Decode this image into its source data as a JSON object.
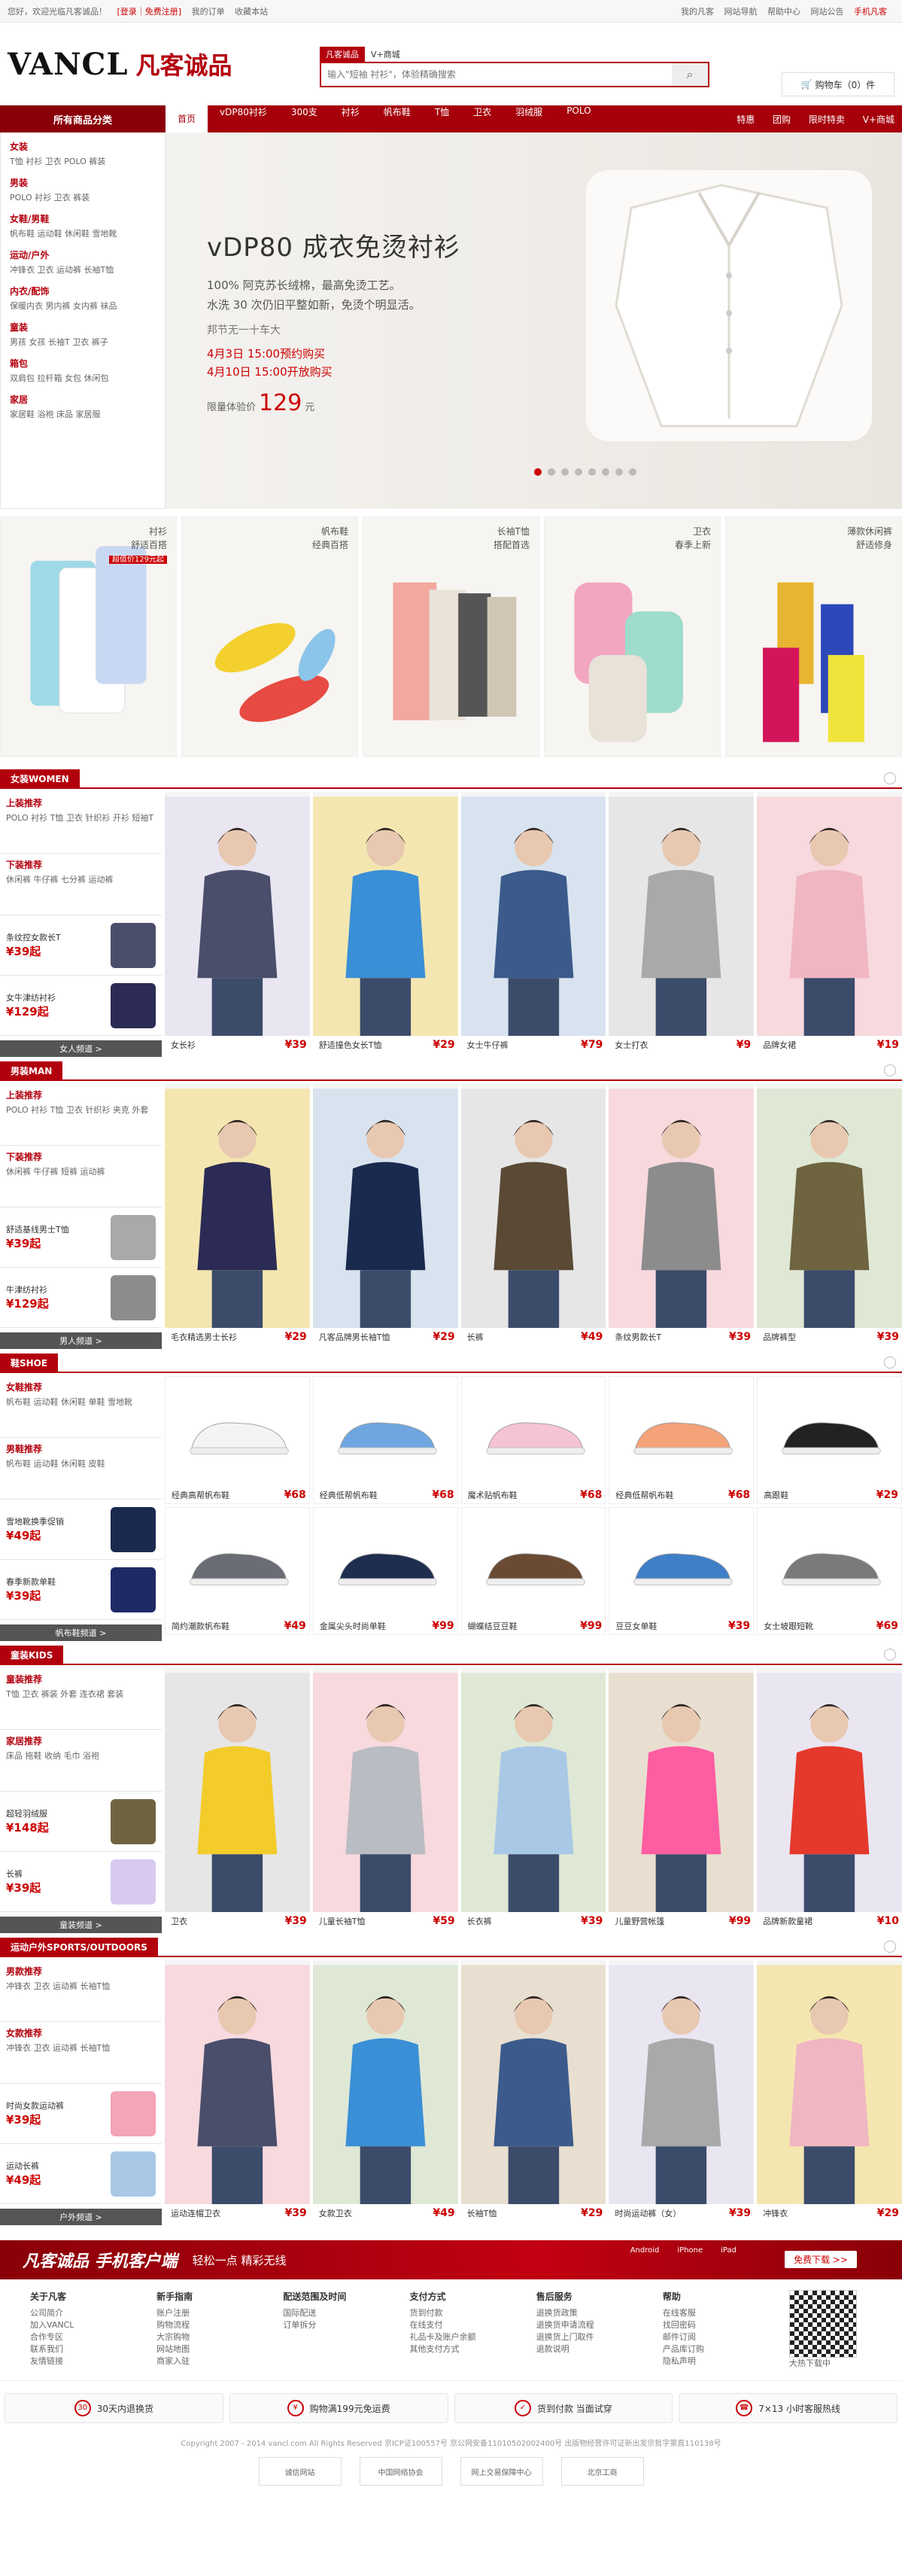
{
  "topbar": {
    "greeting": "您好，欢迎光临凡客诚品！",
    "login": "[登录｜免费注册]",
    "my_order": "我的订单",
    "favorites": "收藏本站",
    "right": [
      "我的凡客",
      "网站导航",
      "帮助中心",
      "网站公告",
      "手机凡客"
    ]
  },
  "header": {
    "logo_en": "VANCL",
    "logo_cn": "凡客诚品",
    "search_tabs": [
      "凡客诚品",
      "V+商城"
    ],
    "search_placeholder": "输入\"短袖 衬衫\"，体验精确搜索",
    "cart": "购物车（0）件"
  },
  "nav": {
    "all": "所有商品分类",
    "items": [
      "首页",
      "vDP80衬衫",
      "300支",
      "衬衫",
      "帆布鞋",
      "T恤",
      "卫衣",
      "羽绒服",
      "POLO"
    ],
    "right": [
      "特惠",
      "团购",
      "限时特卖",
      "V+商城"
    ]
  },
  "categories": [
    {
      "title": "女装",
      "sub": "T恤 衬衫 卫衣 POLO 裤装"
    },
    {
      "title": "男装",
      "sub": "POLO 衬衫 卫衣 裤装"
    },
    {
      "title": "女鞋/男鞋",
      "sub": "帆布鞋 运动鞋 休闲鞋 雪地靴"
    },
    {
      "title": "运动/户外",
      "sub": "冲锋衣 卫衣 运动裤 长袖T恤"
    },
    {
      "title": "内衣/配饰",
      "sub": "保暖内衣 男内裤 女内裤 袜品"
    },
    {
      "title": "童装",
      "sub": "男孩 女孩 长袖T 卫衣 裤子"
    },
    {
      "title": "箱包",
      "sub": "双肩包 拉杆箱 女包 休闲包"
    },
    {
      "title": "家居",
      "sub": "家居鞋 浴袍 床品 家居服"
    }
  ],
  "banner": {
    "title": "vDP80 成衣免烫衬衫",
    "line1": "100% 阿克苏长绒棉，最高免烫工艺。",
    "line2": "水洗 30 次仍旧平整如新，免烫个明显活。",
    "signature": "邦节无一十车大",
    "date1": "4月3日  15:00预约购买",
    "date2": "4月10日  15:00开放购买",
    "price_label": "限量体验价",
    "price": "129",
    "price_unit": "元"
  },
  "promos": [
    {
      "title": "衬衫",
      "sub": "舒适百搭",
      "badge": "超值价129元起"
    },
    {
      "title": "帆布鞋",
      "sub": "经典百搭"
    },
    {
      "title": "长袖T恤",
      "sub": "搭配首选"
    },
    {
      "title": "卫衣",
      "sub": "春季上新"
    },
    {
      "title": "薄款休闲裤",
      "sub": "舒适修身"
    }
  ],
  "sections": [
    {
      "tag": "女装WOMEN",
      "rec1": "上装推荐",
      "rec1s": "POLO 衬衫 T恤 卫衣 针织衫 开衫 短袖T",
      "rec2": "下装推荐",
      "rec2s": "休闲裤 牛仔裤 七分裤 运动裤",
      "minis": [
        {
          "name": "条纹控女款长T",
          "price": "¥39起"
        },
        {
          "name": "女牛津纺衬衫",
          "price": "¥129起"
        }
      ],
      "foot": "女人频道 >",
      "items": [
        {
          "name": "女长衫",
          "price": "¥39"
        },
        {
          "name": "舒适撞色女长T恤",
          "price": "¥29"
        },
        {
          "name": "女士牛仔裤",
          "price": "¥79"
        },
        {
          "name": "女士打衣",
          "price": "¥9"
        },
        {
          "name": "品牌女裙",
          "price": "¥19"
        }
      ]
    },
    {
      "tag": "男装MAN",
      "rec1": "上装推荐",
      "rec1s": "POLO 衬衫 T恤 卫衣 针织衫 夹克 外套",
      "rec2": "下装推荐",
      "rec2s": "休闲裤 牛仔裤 短裤 运动裤",
      "minis": [
        {
          "name": "舒适基线男士T恤",
          "price": "¥39起"
        },
        {
          "name": "牛津纺衬衫",
          "price": "¥129起"
        }
      ],
      "foot": "男人频道 >",
      "items": [
        {
          "name": "毛衣精选男士长衫",
          "price": "¥29"
        },
        {
          "name": "凡客品牌男长袖T恤",
          "price": "¥29"
        },
        {
          "name": "长裤",
          "price": "¥49"
        },
        {
          "name": "条纹男款长T",
          "price": "¥39"
        },
        {
          "name": "品牌裤型",
          "price": "¥39"
        }
      ]
    },
    {
      "tag": "鞋SHOE",
      "rec1": "女鞋推荐",
      "rec1s": "帆布鞋 运动鞋 休闲鞋 单鞋 雪地靴",
      "rec2": "男鞋推荐",
      "rec2s": "帆布鞋 运动鞋 休闲鞋 皮鞋",
      "minis": [
        {
          "name": "雪地靴换季促销",
          "price": "¥49起"
        },
        {
          "name": "春季新款单鞋",
          "price": "¥39起"
        }
      ],
      "foot": "帆布鞋频道 >",
      "items": [
        {
          "name": "经典高帮帆布鞋",
          "price": "¥68"
        },
        {
          "name": "经典低帮帆布鞋",
          "price": "¥68"
        },
        {
          "name": "魔术贴帆布鞋",
          "price": "¥68"
        },
        {
          "name": "经典低帮帆布鞋",
          "price": "¥68"
        },
        {
          "name": "高跟鞋",
          "price": "¥29"
        },
        {
          "name": "简约潮款帆布鞋",
          "price": "¥49"
        },
        {
          "name": "金属尖头时尚单鞋",
          "price": "¥99"
        },
        {
          "name": "蝴蝶结豆豆鞋",
          "price": "¥99"
        },
        {
          "name": "豆豆女单鞋",
          "price": "¥39"
        },
        {
          "name": "女士坡跟短靴",
          "price": "¥69"
        }
      ]
    },
    {
      "tag": "童装KIDS",
      "rec1": "童装推荐",
      "rec1s": "T恤 卫衣 裤装 外套 连衣裙 套装",
      "rec2": "家居推荐",
      "rec2s": "床品 拖鞋 收纳 毛巾 浴袍",
      "minis": [
        {
          "name": "超轻羽绒服",
          "price": "¥148起"
        },
        {
          "name": "长裤",
          "price": "¥39起"
        }
      ],
      "foot": "童装频道 >",
      "items": [
        {
          "name": "卫衣",
          "price": "¥39"
        },
        {
          "name": "儿童长袖T恤",
          "price": "¥59"
        },
        {
          "name": "长衣裤",
          "price": "¥39"
        },
        {
          "name": "儿童野营帐篷",
          "price": "¥99"
        },
        {
          "name": "品牌新款童裙",
          "price": "¥10"
        }
      ]
    },
    {
      "tag": "运动户外SPORTS/OUTDOORS",
      "rec1": "男款推荐",
      "rec1s": "冲锋衣 卫衣 运动裤 长袖T恤",
      "rec2": "女款推荐",
      "rec2s": "冲锋衣 卫衣 运动裤 长袖T恤",
      "minis": [
        {
          "name": "时尚女款运动裤",
          "price": "¥39起"
        },
        {
          "name": "运动长裤",
          "price": "¥49起"
        }
      ],
      "foot": "户外频道 >",
      "items": [
        {
          "name": "运动连帽卫衣",
          "price": "¥39"
        },
        {
          "name": "女款卫衣",
          "price": "¥49"
        },
        {
          "name": "长袖T恤",
          "price": "¥29"
        },
        {
          "name": "时尚运动裤（女）",
          "price": "¥39"
        },
        {
          "name": "冲锋衣",
          "price": "¥29"
        }
      ]
    }
  ],
  "appbar": {
    "title": "凡客诚品 手机客户端",
    "slogan": "轻松一点  精彩无线",
    "platforms": [
      "Android",
      "iPhone",
      "iPad"
    ],
    "download": "免费下载 >>"
  },
  "footer": [
    {
      "title": "关于凡客",
      "items": [
        "公司简介",
        "加入VANCL",
        "合作专区",
        "联系我们",
        "友情链接"
      ]
    },
    {
      "title": "新手指南",
      "items": [
        "账户注册",
        "购物流程",
        "大宗购物",
        "网站地图",
        "商家入驻"
      ]
    },
    {
      "title": "配送范围及时间",
      "items": [
        "国际配送",
        "订单拆分"
      ]
    },
    {
      "title": "支付方式",
      "items": [
        "货到付款",
        "在线支付",
        "礼品卡及账户余额",
        "其他支付方式"
      ]
    },
    {
      "title": "售后服务",
      "items": [
        "退换货政策",
        "退换货申请流程",
        "退换货上门取件",
        "退款说明"
      ]
    },
    {
      "title": "帮助",
      "items": [
        "在线客服",
        "找回密码",
        "邮件订阅",
        "产品库订购",
        "隐私声明"
      ]
    }
  ],
  "qr_caption": "大热下载中",
  "services": [
    {
      "icon": "30",
      "text": "30天内退换货"
    },
    {
      "icon": "¥",
      "text": "购物满199元免运费"
    },
    {
      "icon": "✓",
      "text": "货到付款 当面试穿"
    },
    {
      "icon": "☎",
      "text": "7×13 小时客服热线"
    }
  ],
  "copyright": "Copyright 2007 - 2014 vancl.com All Rights Reserved 京ICP证100557号 京公网安备11010502002400号 出版物经营许可证新出发京批字第直110138号",
  "trust": [
    "诚信网站",
    "中国网络协会",
    "网上交易保障中心",
    "北京工商"
  ]
}
